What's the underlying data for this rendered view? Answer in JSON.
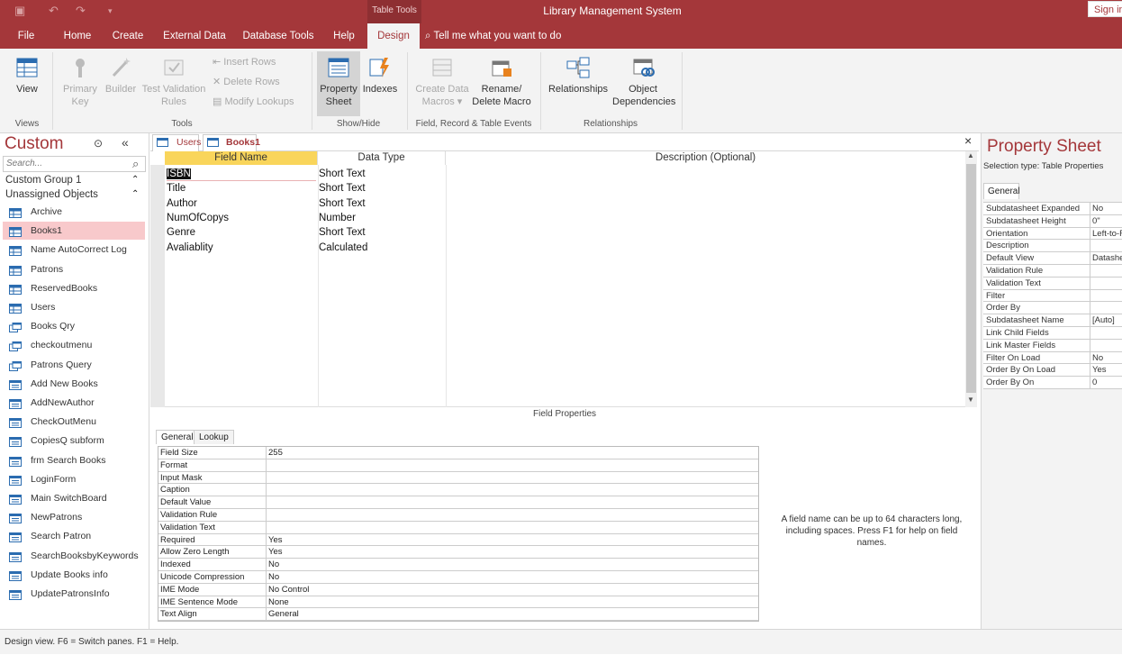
{
  "titlebar": {
    "context_tab": "Table Tools",
    "app_title": "Library Management System",
    "sign_in": "Sign in"
  },
  "ribbon_tabs": [
    "File",
    "Home",
    "Create",
    "External Data",
    "Database Tools",
    "Help",
    "Design"
  ],
  "tell_me": "Tell me what you want to do",
  "ribbon": {
    "view": "View",
    "primary_key": [
      "Primary",
      "Key"
    ],
    "builder": "Builder",
    "test_validation": [
      "Test Validation",
      "Rules"
    ],
    "insert_rows": "Insert Rows",
    "delete_rows": "Delete Rows",
    "modify_lookups": "Modify Lookups",
    "property_sheet": [
      "Property",
      "Sheet"
    ],
    "indexes": "Indexes",
    "create_data_macros": [
      "Create Data",
      "Macros"
    ],
    "rename_delete_macro": [
      "Rename/",
      "Delete Macro"
    ],
    "relationships": "Relationships",
    "object_dependencies": [
      "Object",
      "Dependencies"
    ],
    "groups": {
      "views": "Views",
      "tools": "Tools",
      "show_hide": "Show/Hide",
      "field_events": "Field, Record & Table Events",
      "relationships": "Relationships"
    }
  },
  "nav": {
    "title": "Custom",
    "search_placeholder": "Search...",
    "groups": [
      "Custom Group 1",
      "Unassigned Objects"
    ],
    "items": [
      {
        "label": "Archive",
        "type": "table"
      },
      {
        "label": "Books1",
        "type": "table",
        "selected": true
      },
      {
        "label": "Name AutoCorrect Log",
        "type": "table"
      },
      {
        "label": "Patrons",
        "type": "table"
      },
      {
        "label": "ReservedBooks",
        "type": "table"
      },
      {
        "label": "Users",
        "type": "table"
      },
      {
        "label": "Books Qry",
        "type": "query"
      },
      {
        "label": "checkoutmenu",
        "type": "query"
      },
      {
        "label": "Patrons Query",
        "type": "query"
      },
      {
        "label": "Add New Books",
        "type": "form"
      },
      {
        "label": "AddNewAuthor",
        "type": "form"
      },
      {
        "label": "CheckOutMenu",
        "type": "form"
      },
      {
        "label": "CopiesQ subform",
        "type": "form"
      },
      {
        "label": "frm Search Books",
        "type": "form"
      },
      {
        "label": "LoginForm",
        "type": "form"
      },
      {
        "label": "Main SwitchBoard",
        "type": "form"
      },
      {
        "label": "NewPatrons",
        "type": "form"
      },
      {
        "label": "Search Patron",
        "type": "form"
      },
      {
        "label": "SearchBooksbyKeywords",
        "type": "form"
      },
      {
        "label": "Update Books info",
        "type": "form"
      },
      {
        "label": "UpdatePatronsInfo",
        "type": "form"
      }
    ]
  },
  "doc_tabs": [
    "Users",
    "Books1"
  ],
  "close_glyph": "×",
  "grid": {
    "headers": [
      "Field Name",
      "Data Type",
      "Description (Optional)"
    ],
    "rows": [
      [
        "ISBN",
        "Short Text"
      ],
      [
        "Title",
        "Short Text"
      ],
      [
        "Author",
        "Short Text"
      ],
      [
        "NumOfCopys",
        "Number"
      ],
      [
        "Genre",
        "Short Text"
      ],
      [
        "Avaliablity",
        "Calculated"
      ]
    ]
  },
  "field_properties": {
    "title": "Field Properties",
    "tabs": [
      "General",
      "Lookup"
    ],
    "rows": [
      [
        "Field Size",
        "255"
      ],
      [
        "Format",
        ""
      ],
      [
        "Input Mask",
        ""
      ],
      [
        "Caption",
        ""
      ],
      [
        "Default Value",
        ""
      ],
      [
        "Validation Rule",
        ""
      ],
      [
        "Validation Text",
        ""
      ],
      [
        "Required",
        "Yes"
      ],
      [
        "Allow Zero Length",
        "Yes"
      ],
      [
        "Indexed",
        "No"
      ],
      [
        "Unicode Compression",
        "No"
      ],
      [
        "IME Mode",
        "No Control"
      ],
      [
        "IME Sentence Mode",
        "None"
      ],
      [
        "Text Align",
        "General"
      ]
    ],
    "hint": "A field name can be up to 64 characters long, including spaces. Press F1 for help on field names."
  },
  "property_sheet": {
    "title": "Property Sheet",
    "selection": "Selection type: Table Properties",
    "tab": "General",
    "rows": [
      [
        "Subdatasheet Expanded",
        "No"
      ],
      [
        "Subdatasheet Height",
        "0\""
      ],
      [
        "Orientation",
        "Left-to-Right"
      ],
      [
        "Description",
        ""
      ],
      [
        "Default View",
        "Datasheet"
      ],
      [
        "Validation Rule",
        ""
      ],
      [
        "Validation Text",
        ""
      ],
      [
        "Filter",
        ""
      ],
      [
        "Order By",
        ""
      ],
      [
        "Subdatasheet Name",
        "[Auto]"
      ],
      [
        "Link Child Fields",
        ""
      ],
      [
        "Link Master Fields",
        ""
      ],
      [
        "Filter On Load",
        "No"
      ],
      [
        "Order By On Load",
        "Yes"
      ],
      [
        "Order By On",
        "0"
      ]
    ]
  },
  "status": "Design view.  F6 = Switch panes.  F1 = Help.",
  "colors": {
    "accent": "#a4373a",
    "selected": "#f8c9cb",
    "header_highlight": "#f9d55b"
  }
}
